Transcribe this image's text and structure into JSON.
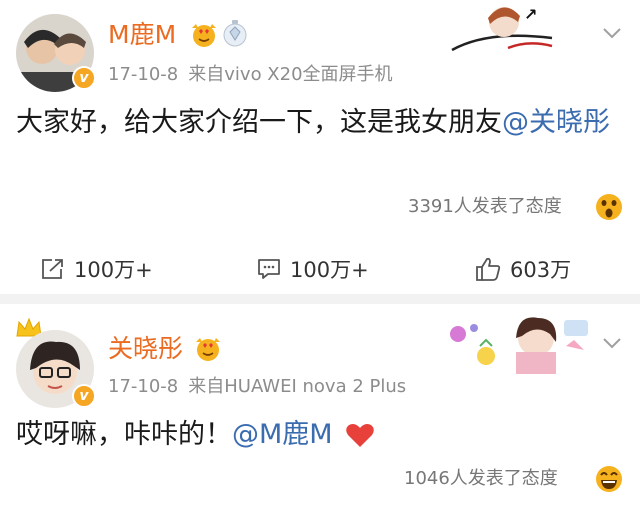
{
  "colors": {
    "name": "#ea6b21",
    "mention": "#3b6cb0",
    "meta": "#8c8c8c",
    "divider": "#f2f2f2",
    "verified": "#f5a623",
    "heart": "#e8413b"
  },
  "icons": {
    "more": "chevron-down-icon",
    "repost": "share-icon",
    "comment": "comment-icon",
    "like": "thumbs-up-icon"
  },
  "post1": {
    "author": "M鹿M",
    "time": "17-10-8",
    "source": "来自vivo X20全面屏手机",
    "text_before": "大家好，给大家介绍一下，这是我女朋友",
    "mention": "@关晓彤",
    "reactions": "3391人发表了态度",
    "actions": {
      "repost": "100万+",
      "comment": "100万+",
      "like": "603万"
    }
  },
  "post2": {
    "author": "关晓彤",
    "time": "17-10-8",
    "source": "来自HUAWEI nova 2 Plus",
    "text_before": "哎呀嘛，咔咔的！",
    "mention": "@M鹿M",
    "reactions": "1046人发表了态度"
  }
}
